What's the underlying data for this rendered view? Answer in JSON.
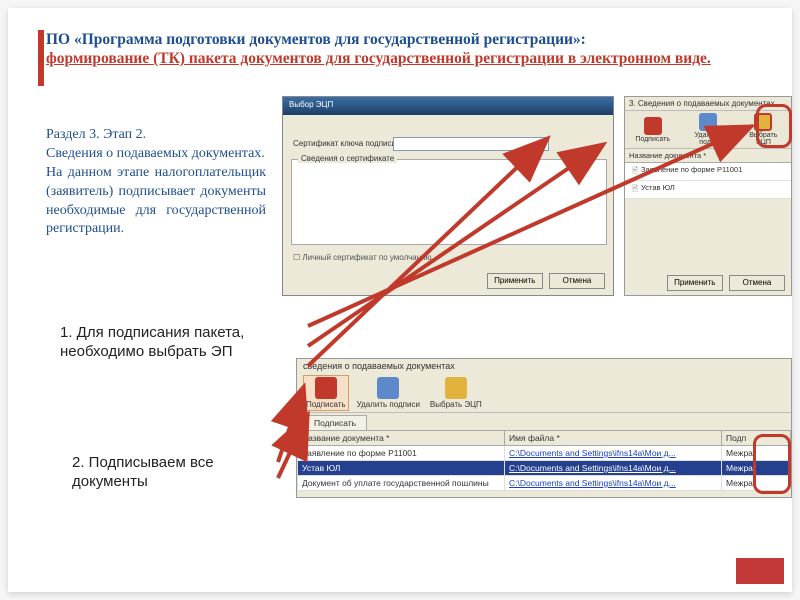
{
  "title": {
    "line1": "ПО «Программа подготовки документов для государственной регистрации»:",
    "line2": "формирование (ТК) пакета документов для государственной регистрации в электронном виде."
  },
  "body": {
    "heading": "Раздел 3. Этап 2.",
    "p1": "Сведения о подаваемых документах.",
    "p2": "На данном этапе налогоплательщик (заявитель) подписывает документы необходимые для государственной регистрации."
  },
  "steps": {
    "s1": "1.  Для подписания пакета, необходимо выбрать ЭП",
    "s2": "2. Подписываем все документы"
  },
  "dlg1": {
    "title": "Выбор ЭЦП",
    "cert_label": "Сертификат ключа подписи",
    "group_label": "Сведения о сертификате",
    "checkbox": "Личный сертификат по умолчанию",
    "btn_ok": "Применить",
    "btn_cancel": "Отмена"
  },
  "panel": {
    "header": "3. Сведения о подаваемых документах",
    "tools": {
      "sign": "Подписать",
      "del": "Удалить подп.",
      "sel": "Выбрать ЭЦП"
    },
    "col": "Название документа *",
    "rows": [
      "Заявление по форме Р11001",
      "Устав ЮЛ"
    ],
    "btn_ok": "Применить",
    "btn_cancel": "Отмена"
  },
  "dlg2": {
    "header": "сведения о подаваемых документах",
    "tools": {
      "sign": "Подписать",
      "del": "Удалить подписи",
      "sel": "Выбрать ЭЦП"
    },
    "tab": "Подписать",
    "cols": {
      "name": "Название документа *",
      "file": "Имя файла *",
      "sig": "Подп"
    },
    "file": "C:\\Documents and Settings\\ifns14a\\Мои д...",
    "sig": "Межра",
    "rows": [
      "Заявление по форме Р11001",
      "Устав ЮЛ",
      "Документ об уплате государственной пошлины"
    ]
  }
}
